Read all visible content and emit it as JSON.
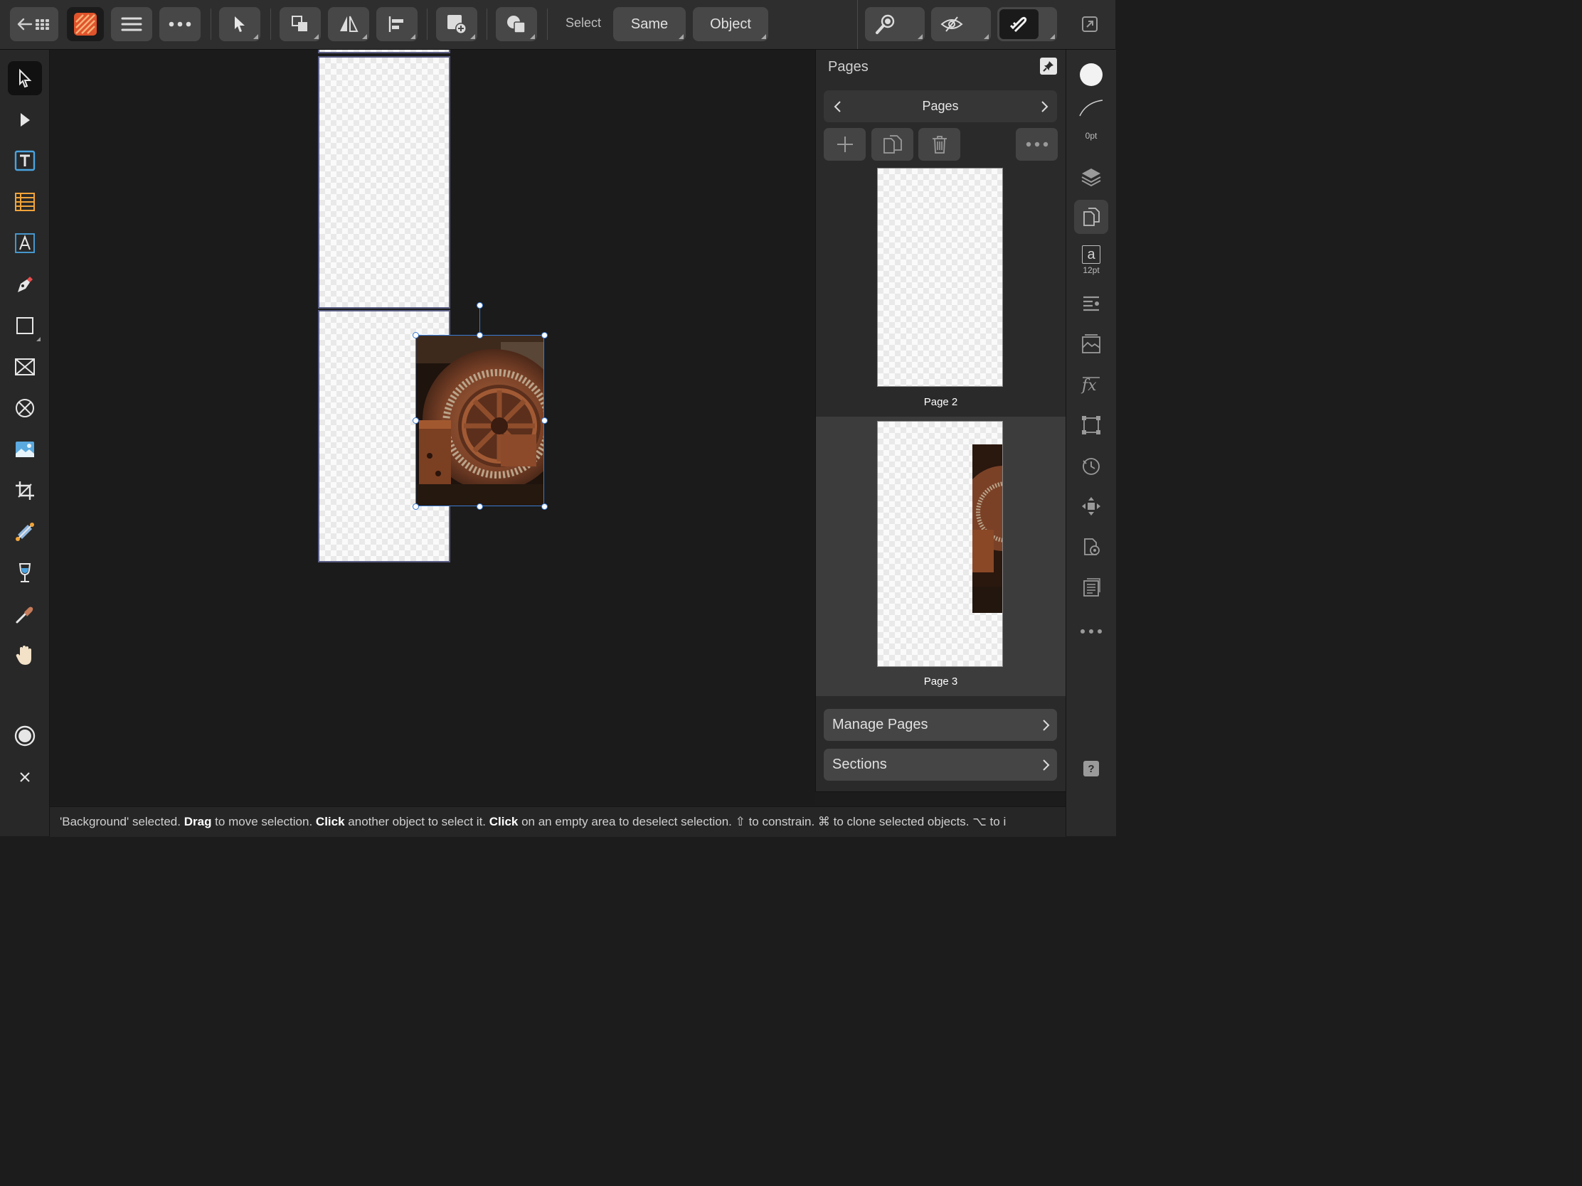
{
  "toolbar": {
    "select_label": "Select",
    "same_label": "Same",
    "object_label": "Object"
  },
  "panel": {
    "title": "Pages",
    "nav_title": "Pages",
    "pages": [
      {
        "label": "Page 2"
      },
      {
        "label": "Page 3"
      }
    ],
    "manage_pages_label": "Manage Pages",
    "sections_label": "Sections"
  },
  "studio": {
    "stroke_width": "0pt",
    "font_size": "12pt",
    "text_glyph": "a"
  },
  "status": {
    "p1": "'Background' selected. ",
    "b1": "Drag",
    "p2": " to move selection. ",
    "b2": "Click",
    "p3": " another object to select it. ",
    "b3": "Click",
    "p4": " on an empty area to deselect selection. ⇧ to constrain. ⌘ to clone selected objects. ⌥ to i"
  },
  "colors": {
    "app_bg": "#1c1c1c",
    "toolbar_bg": "#2e2e2e",
    "selection_blue": "#3a7bd5",
    "page_border": "#5b5f86",
    "app_icon_orange": "#e0532b"
  },
  "icons": [
    "back-arrow-icon",
    "grid-icon",
    "app-icon",
    "menu-icon",
    "more-icon",
    "move-tool-icon",
    "arrange-icon",
    "flip-icon",
    "align-icon",
    "insert-page-icon",
    "boolean-icon",
    "zoom-icon",
    "view-mode-icon",
    "snapping-icon",
    "fullscreen-icon"
  ]
}
